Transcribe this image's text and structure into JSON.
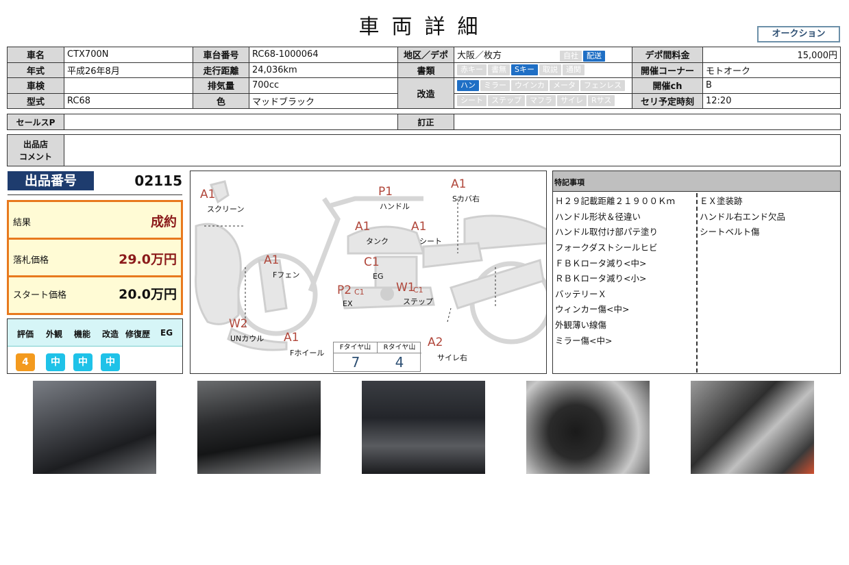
{
  "title": "車両詳細",
  "auction_button": "オークション",
  "spec": {
    "name_label": "車名",
    "name": "CTX700N",
    "frame_label": "車台番号",
    "frame": "RC68-1000064",
    "area_label": "地区／デポ",
    "area": "大阪／枚方",
    "area_opts": [
      "自社",
      "配送"
    ],
    "depo_fee_label": "デポ間料金",
    "depo_fee": "15,000円",
    "year_label": "年式",
    "year": "平成26年8月",
    "mileage_label": "走行距離",
    "mileage": "24,036km",
    "docs_label": "書類",
    "docs_opts": [
      "赤キー",
      "書無",
      "Sキー",
      "取説",
      "通関"
    ],
    "corner_label": "開催コーナー",
    "corner": "モトオーク",
    "inspection_label": "車検",
    "inspection": "",
    "displacement_label": "排気量",
    "displacement": "700cc",
    "mods_label": "改造",
    "mods_row1": [
      "ハン",
      "ミラー",
      "ウインカ",
      "メータ",
      "フェンレス"
    ],
    "mods_row2": [
      "シート",
      "ステップ",
      "マフラ",
      "サイレ",
      "Rサス"
    ],
    "ch_label": "開催ch",
    "ch": "B",
    "model_label": "型式",
    "model": "RC68",
    "color_label": "色",
    "color": "マッドブラック",
    "time_label": "セリ予定時刻",
    "time": "12:20",
    "salespoint_label": "セールスP",
    "salespoint": "",
    "correction_label": "訂正",
    "correction": "",
    "comment_label_1": "出品店",
    "comment_label_2": "コメント",
    "comment": ""
  },
  "lot": {
    "label": "出品番号",
    "number": "02115"
  },
  "result": {
    "result_label": "結果",
    "result": "成約",
    "bid_label": "落札価格",
    "bid": "29.0万円",
    "start_label": "スタート価格",
    "start": "20.0万円"
  },
  "evaluation": {
    "headers": [
      "評価",
      "外観",
      "機能",
      "改造",
      "修復歴",
      "EG"
    ],
    "values": [
      "4",
      "中",
      "中",
      "中"
    ]
  },
  "diagram": {
    "labels": {
      "screen": "スクリーン",
      "handle": "ハンドル",
      "scover": "Sカバ右",
      "tank": "タンク",
      "seat": "シート",
      "ffender": "Fフェン",
      "eg": "EG",
      "ex": "EX",
      "step": "ステップ",
      "uncowl": "UNカウル",
      "fwheel": "Fホイール",
      "silencer": "サイレ右"
    },
    "codes": {
      "screen": "A1",
      "handle": "P1",
      "scover": "A1",
      "tank": "A1",
      "seat": "A1",
      "ffender": "A1",
      "eg": "C1",
      "ex": "P2",
      "ex_sub": "C1",
      "step": "W1",
      "step_sub": "C1",
      "uncowl": "W2",
      "fwheel": "A1",
      "silencer": "A2"
    },
    "tire": {
      "f_label": "Fタイヤ山",
      "f": "7",
      "r_label": "Rタイヤ山",
      "r": "4"
    }
  },
  "notes": {
    "header": "特記事項",
    "left": [
      "Ｈ２９記載距離２１９００Ｋｍ",
      "ハンドル形状＆径違い",
      "ハンドル取付け部パテ塗り",
      "フォークダストシールヒビ",
      "ＦＢＫロータ減り<中>",
      "ＲＢＫロータ減り<小>",
      "バッテリーＸ",
      "ウィンカー傷<中>",
      "外観薄い線傷",
      "ミラー傷<中>"
    ],
    "right": [
      "ＥＸ塗装跡",
      "ハンドル右エンド欠品",
      "シートベルト傷"
    ]
  },
  "colors": {
    "accent": "#1f6fc5",
    "result_border": "#e8791e",
    "eval_orange": "#f39a1e",
    "eval_cyan": "#1fc2e8"
  }
}
